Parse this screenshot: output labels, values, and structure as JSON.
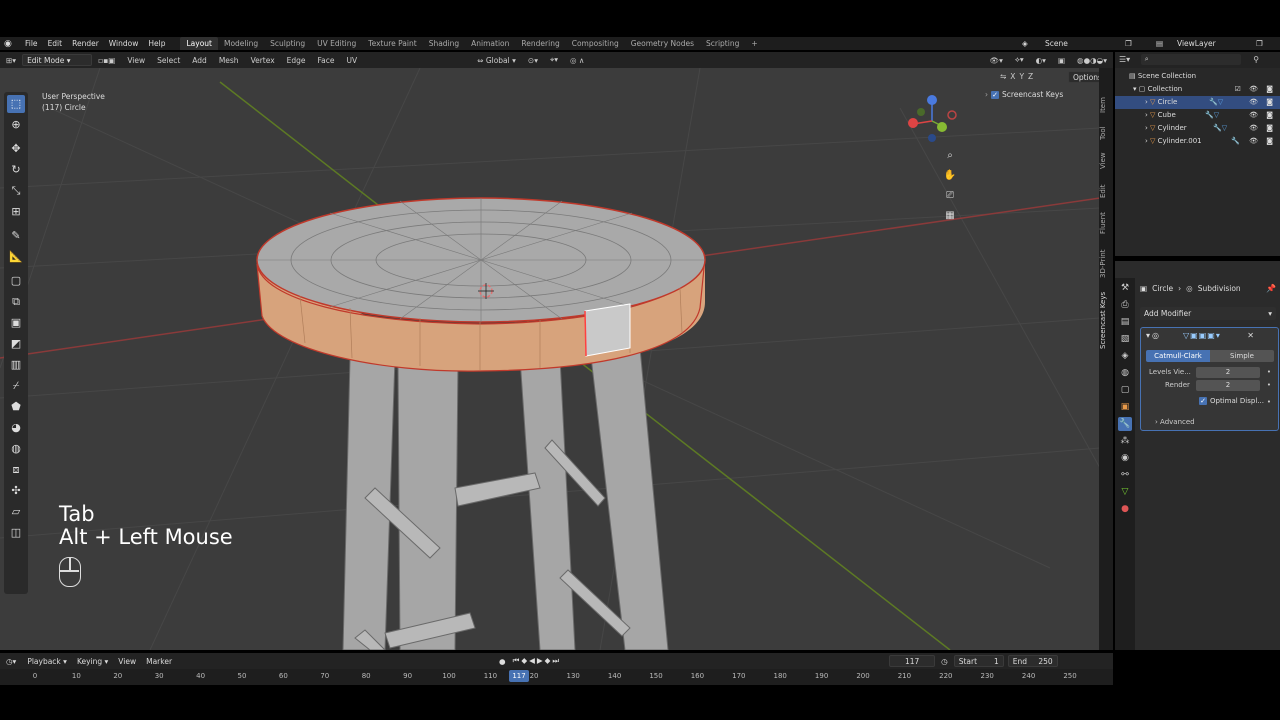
{
  "menu": {
    "items": [
      "File",
      "Edit",
      "Render",
      "Window",
      "Help"
    ],
    "workspaces": [
      "Layout",
      "Modeling",
      "Sculpting",
      "UV Editing",
      "Texture Paint",
      "Shading",
      "Animation",
      "Rendering",
      "Compositing",
      "Geometry Nodes",
      "Scripting"
    ],
    "active_workspace": "Layout",
    "scene": "Scene",
    "view_layer": "ViewLayer"
  },
  "viewport_header": {
    "mode": "Edit Mode",
    "items": [
      "View",
      "Select",
      "Add",
      "Mesh",
      "Vertex",
      "Edge",
      "Face",
      "UV"
    ],
    "orientation": "Global",
    "axes": [
      "X",
      "Y",
      "Z"
    ],
    "options": "Options"
  },
  "viewport": {
    "perspective": "User Perspective",
    "object_info": "(117) Circle",
    "screencast_keys_label": "Screencast Keys",
    "key_line1": "Tab",
    "key_line2": "Alt + Left Mouse"
  },
  "side_tabs": [
    "Item",
    "Tool",
    "View",
    "Edit",
    "Fluent",
    "3D-Print",
    "Screencast Keys"
  ],
  "outliner": {
    "root": "Scene Collection",
    "collection": "Collection",
    "objects": [
      "Circle",
      "Cube",
      "Cylinder",
      "Cylinder.001"
    ],
    "selected": "Circle"
  },
  "properties": {
    "breadcrumb_object": "Circle",
    "breadcrumb_modifier": "Subdivision",
    "add_modifier": "Add Modifier",
    "tab_catmull": "Catmull-Clark",
    "tab_simple": "Simple",
    "levels_label": "Levels Vie...",
    "levels_value": "2",
    "render_label": "Render",
    "render_value": "2",
    "optimal_label": "Optimal Displ...",
    "advanced_label": "Advanced"
  },
  "timeline": {
    "items": [
      "Playback",
      "Keying",
      "View",
      "Marker"
    ],
    "current_frame": "117",
    "start_label": "Start",
    "start_value": "1",
    "end_label": "End",
    "end_value": "250",
    "ticks": [
      "0",
      "10",
      "20",
      "30",
      "40",
      "50",
      "60",
      "70",
      "80",
      "90",
      "100",
      "110",
      "120",
      "130",
      "140",
      "150",
      "160",
      "170",
      "180",
      "190",
      "200",
      "210",
      "220",
      "230",
      "240",
      "250"
    ]
  },
  "colors": {
    "accent": "#4772b3",
    "viewport_bg": "#3c3c3c",
    "seat_side": "#d8a27a",
    "axis_x": "#b04040",
    "axis_y": "#6b8a2a"
  }
}
